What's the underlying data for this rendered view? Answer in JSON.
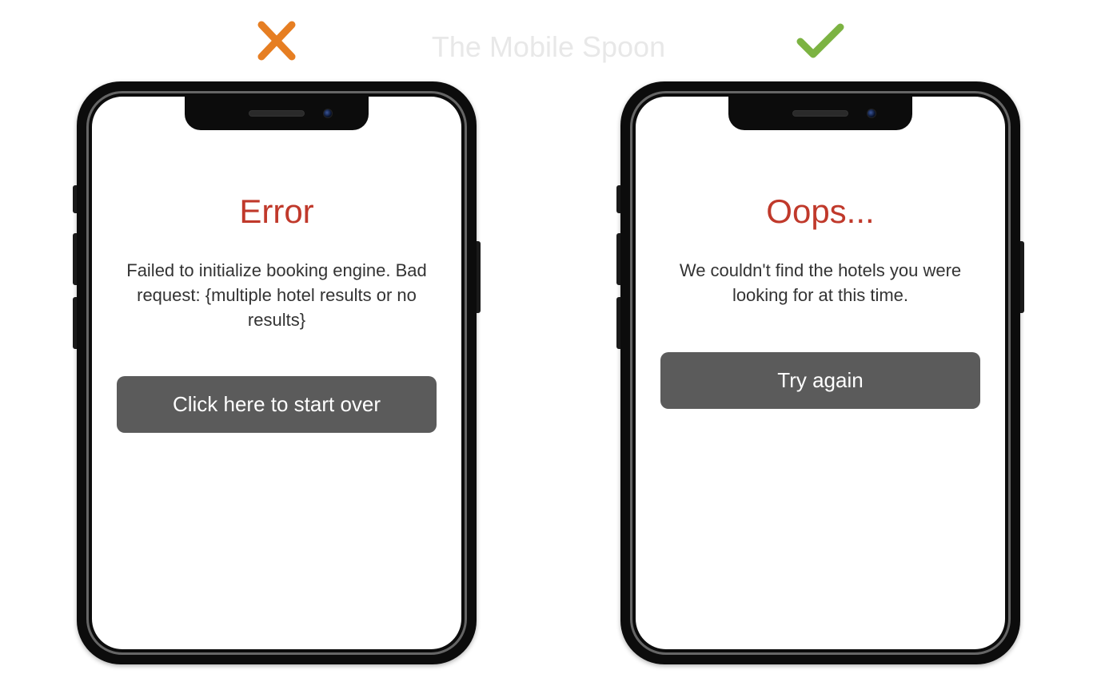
{
  "watermark": "The Mobile Spoon",
  "bad": {
    "title": "Error",
    "body": "Failed to initialize booking engine. Bad request: {multiple hotel results or no results}",
    "button": "Click here to start over"
  },
  "good": {
    "title": "Oops...",
    "body": "We couldn't find the hotels you were looking for at this time.",
    "button": "Try again"
  },
  "colors": {
    "error_title": "#c0392b",
    "cross": "#e67e22",
    "check": "#7cb342",
    "button_bg": "#5b5b5b"
  }
}
